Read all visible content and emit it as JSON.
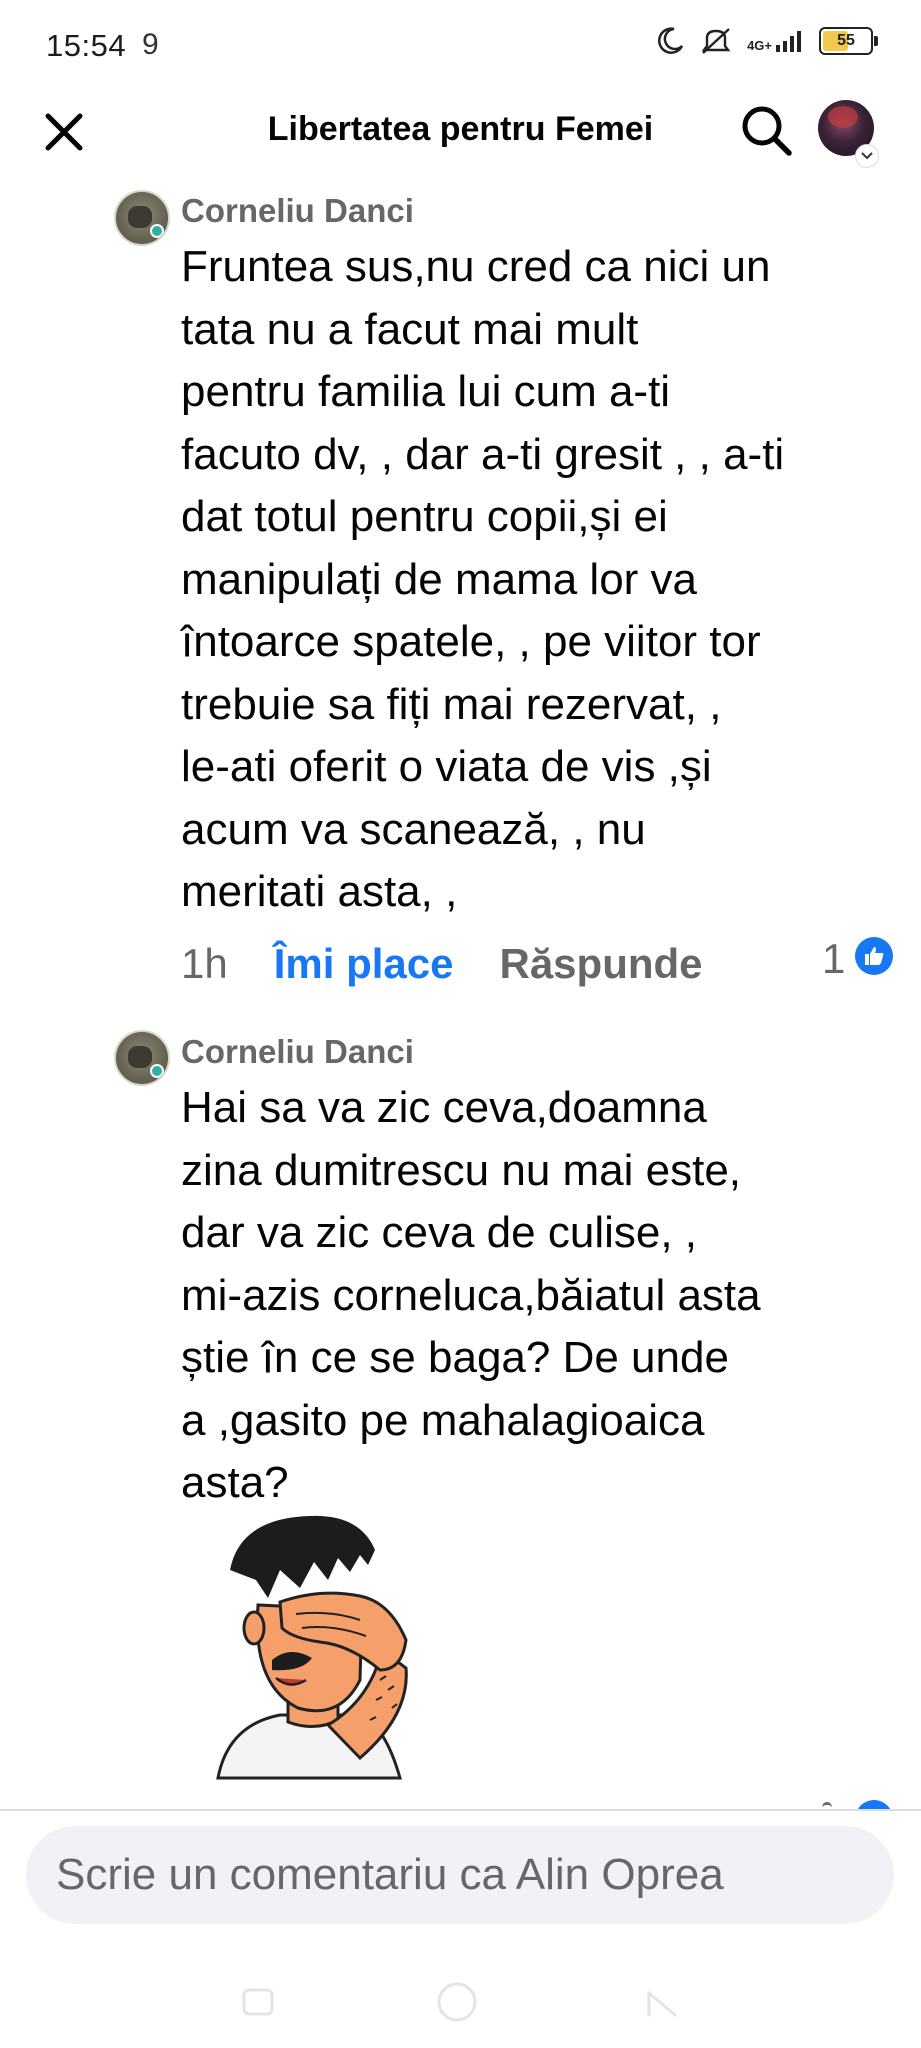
{
  "status_bar": {
    "time": "15:54",
    "location_glyph": "9",
    "network_label": "4G+",
    "battery_percent": "55",
    "battery_level": 0.55,
    "icons": [
      "moon-icon",
      "mute-vibrate-icon",
      "signal-icon",
      "battery-icon"
    ]
  },
  "header": {
    "title": "Libertatea pentru Femei",
    "close_icon": "close-icon",
    "search_icon": "search-icon"
  },
  "comments": [
    {
      "author": "Corneliu Danci",
      "text": "Fruntea sus,nu cred ca nici un\ntata  nu a facut mai mult\npentru familia lui cum a-ti\nfacuto dv, , dar a-ti gresit , , a-ti\ndat totul pentru copii,și ei\nmanipulați de mama lor  va\nîntoarce spatele, , pe viitor tor\ntrebuie sa fiți mai rezervat, ,\nle-ati oferit o viata de vis ,și\nacum va scanează, , nu\nmeritati asta, ,",
      "time": "1h",
      "like_label": "Îmi place",
      "reply_label": "Răspunde",
      "reaction_count": "1"
    },
    {
      "author": "Corneliu Danci",
      "text": "Hai sa va zic ceva,doamna\nzina dumitrescu nu mai este,\ndar va zic ceva de culise, ,\nmi-azis corneluca,băiatul asta\nștie în ce se baga? De unde\na ,gasito pe mahalagioaica\nasta?",
      "sticker": "facepalm-sticker"
    }
  ],
  "composer": {
    "placeholder": "Scrie un comentariu ca Alin Oprea"
  },
  "colors": {
    "accent": "#1877f2",
    "secondary_text": "#65676b",
    "input_bg": "#f0f2f5"
  }
}
